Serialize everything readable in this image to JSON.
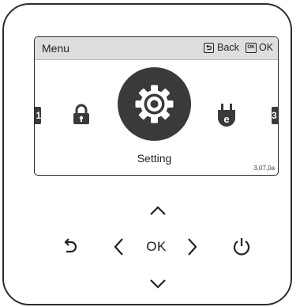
{
  "screen": {
    "header": {
      "title": "Menu",
      "back_label": "Back",
      "ok_icon_text": "OK",
      "ok_label": "OK"
    },
    "carousel": {
      "prev_item_number": "1",
      "next_item_number": "3",
      "items": [
        {
          "icon": "lock-icon"
        },
        {
          "icon": "gear-icon",
          "label": "Setting",
          "selected": true
        },
        {
          "icon": "plug-icon",
          "badge": "e"
        }
      ]
    },
    "version": "3,07,0a"
  },
  "keypad": {
    "center_label": "OK",
    "buttons": [
      "up-arrow-icon",
      "left-arrow-icon",
      "right-arrow-icon",
      "down-arrow-icon",
      "back-icon",
      "power-icon"
    ]
  },
  "colors": {
    "header_bg": "#dedede",
    "icon_dark": "#3a3a3a",
    "frame": "#2c2c2c"
  }
}
